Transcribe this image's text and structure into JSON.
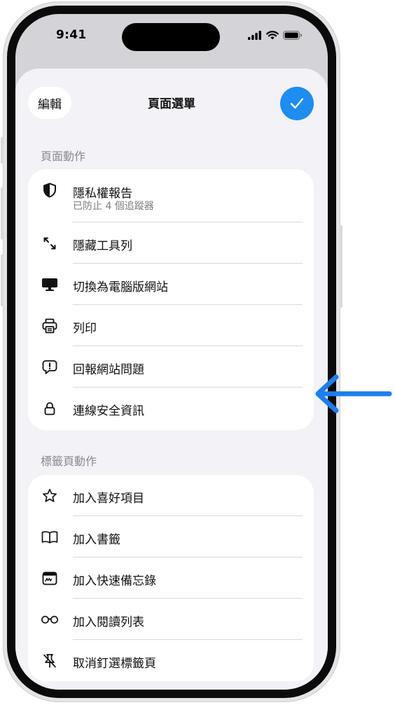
{
  "status_bar": {
    "time": "9:41"
  },
  "sheet": {
    "edit_label": "編輯",
    "title": "頁面選單"
  },
  "page_actions": {
    "header": "頁面動作",
    "items": [
      {
        "label": "隱私權報告",
        "sublabel": "已防止 4 個追蹤器",
        "icon": "shield-icon"
      },
      {
        "label": "隱藏工具列",
        "icon": "collapse-arrows-icon"
      },
      {
        "label": "切換為電腦版網站",
        "icon": "desktop-icon"
      },
      {
        "label": "列印",
        "icon": "printer-icon"
      },
      {
        "label": "回報網站問題",
        "icon": "report-bubble-icon"
      },
      {
        "label": "連線安全資訊",
        "icon": "lock-icon"
      }
    ]
  },
  "tab_actions": {
    "header": "標籤頁動作",
    "items": [
      {
        "label": "加入喜好項目",
        "icon": "star-icon"
      },
      {
        "label": "加入書籤",
        "icon": "book-icon"
      },
      {
        "label": "加入快速備忘錄",
        "icon": "quick-note-icon"
      },
      {
        "label": "加入閱讀列表",
        "icon": "glasses-icon"
      },
      {
        "label": "取消釘選標籤頁",
        "icon": "unpin-icon"
      }
    ]
  },
  "colors": {
    "accent": "#1e8cf1",
    "callout_arrow": "#1b7ff0"
  }
}
